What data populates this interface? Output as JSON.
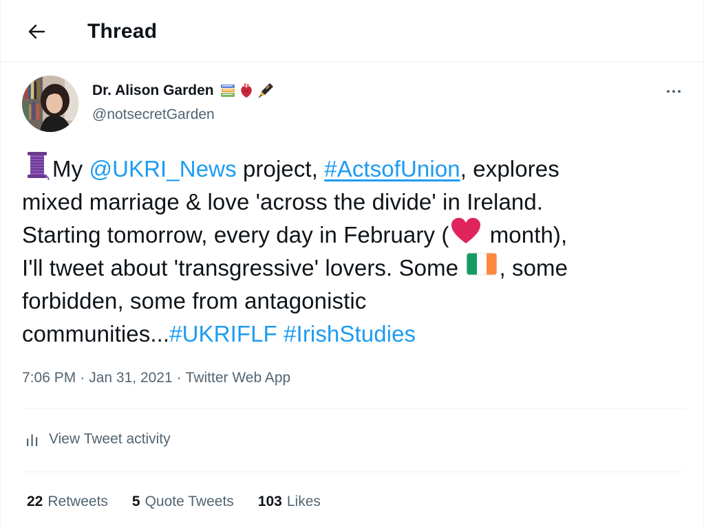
{
  "header": {
    "title": "Thread"
  },
  "author": {
    "name": "Dr. Alison Garden",
    "handle": "@notsecretGarden",
    "name_emojis": [
      "books-icon",
      "anatomical-heart-icon",
      "fountain-pen-icon"
    ]
  },
  "tweet": {
    "lines": [
      {
        "parts": [
          {
            "kind": "emoji",
            "icon": "thread-spool-icon"
          },
          {
            "kind": "text",
            "text": "My "
          },
          {
            "kind": "mention",
            "text": "@UKRI_News"
          },
          {
            "kind": "text",
            "text": " project, "
          },
          {
            "kind": "hashtag_u",
            "text": "#ActsofUnion"
          },
          {
            "kind": "text",
            "text": ", explores"
          }
        ]
      },
      {
        "parts": [
          {
            "kind": "text",
            "text": "mixed marriage & love 'across the divide' in Ireland."
          }
        ]
      },
      {
        "parts": [
          {
            "kind": "text",
            "text": "Starting tomorrow, every day in February ("
          },
          {
            "kind": "emoji",
            "icon": "red-heart-icon"
          },
          {
            "kind": "text",
            "text": " month),"
          }
        ]
      },
      {
        "parts": [
          {
            "kind": "text",
            "text": "I'll tweet about 'transgressive' lovers. Some "
          },
          {
            "kind": "emoji",
            "icon": "ireland-flag-icon"
          },
          {
            "kind": "text",
            "text": ", some"
          }
        ]
      },
      {
        "parts": [
          {
            "kind": "text",
            "text": "forbidden, some from antagonistic"
          }
        ]
      },
      {
        "parts": [
          {
            "kind": "text",
            "text": "communities..."
          },
          {
            "kind": "hashtag",
            "text": "#UKRIFLF"
          },
          {
            "kind": "text",
            "text": " "
          },
          {
            "kind": "hashtag",
            "text": "#IrishStudies"
          }
        ]
      }
    ]
  },
  "meta": {
    "time": "7:06 PM",
    "separator": "·",
    "date": "Jan 31, 2021",
    "source": "Twitter Web App"
  },
  "activity": {
    "label": "View Tweet activity",
    "icon": "analytics-icon"
  },
  "stats": [
    {
      "count": "22",
      "label": "Retweets"
    },
    {
      "count": "5",
      "label": "Quote Tweets"
    },
    {
      "count": "103",
      "label": "Likes"
    }
  ],
  "colors": {
    "link": "#1d9bf0",
    "text": "#0f1419",
    "secondary": "#536471",
    "divider": "#eff3f4",
    "heart": "#e0245e"
  }
}
